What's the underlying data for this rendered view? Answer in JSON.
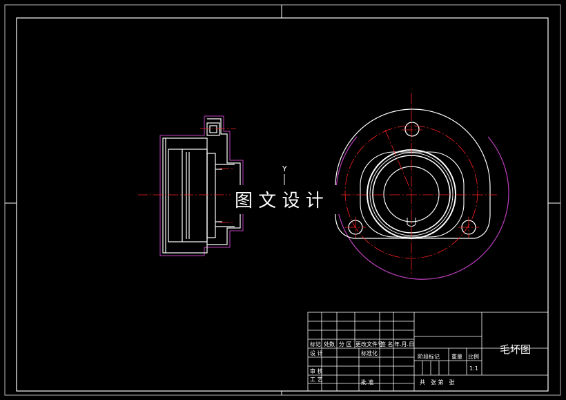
{
  "watermark": "图 文 设 计",
  "axis_label": "Y",
  "title_block": {
    "drawing_title": "毛坏图",
    "scale_value": "1:1",
    "headers": {
      "mark": "标记",
      "count": "处数",
      "zone": "分 区",
      "change_doc": "更改文件号",
      "signature": "签 名",
      "date": "年.月.日",
      "design": "设 计",
      "standardization": "标准化",
      "stage_mark": "阶段标记",
      "weight": "重量",
      "scale": "比例",
      "review": "审 核",
      "process": "工 艺",
      "approve": "批 准",
      "sheets": "共　张 第　张"
    }
  },
  "colors": {
    "background": "#000000",
    "line": "#ffffff",
    "center_line": "#ff2020",
    "outline": "#c040c0"
  }
}
